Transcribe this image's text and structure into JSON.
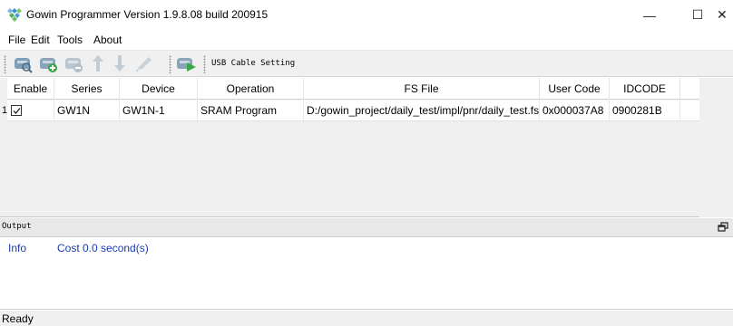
{
  "window": {
    "title": "Gowin Programmer Version 1.9.8.08 build 200915",
    "minimize_glyph": "—",
    "maximize_glyph": "☐",
    "close_glyph": "✕"
  },
  "menu": {
    "items": [
      {
        "label": "File"
      },
      {
        "label": "Edit"
      },
      {
        "label": "Tools"
      },
      {
        "label": "About"
      }
    ]
  },
  "toolbar": {
    "cable_setting_label": "USB Cable Setting",
    "icons": [
      "scan-device-icon",
      "add-device-icon",
      "remove-device-icon",
      "move-up-icon",
      "move-down-icon",
      "edit-config-icon",
      "program-config-icon"
    ]
  },
  "table": {
    "columns": [
      "Enable",
      "Series",
      "Device",
      "Operation",
      "FS File",
      "User Code",
      "IDCODE"
    ],
    "rows": [
      {
        "index": "1",
        "enabled": true,
        "series": "GW1N",
        "device": "GW1N-1",
        "operation": "SRAM Program",
        "fs_file": "D:/gowin_project/daily_test/impl/pnr/daily_test.fs",
        "user_code": "0x000037A8",
        "idcode": "0900281B"
      }
    ]
  },
  "output": {
    "title": "Output",
    "logs": [
      {
        "level": "Info",
        "message": "Cost 0.0 second(s)"
      }
    ]
  },
  "status": {
    "text": "Ready"
  },
  "colors": {
    "log_text": "#1a3ab0",
    "toolbar_bg": "#f0f0f0",
    "icon_green": "#3aa84a",
    "icon_gray": "#8a9aa8"
  }
}
